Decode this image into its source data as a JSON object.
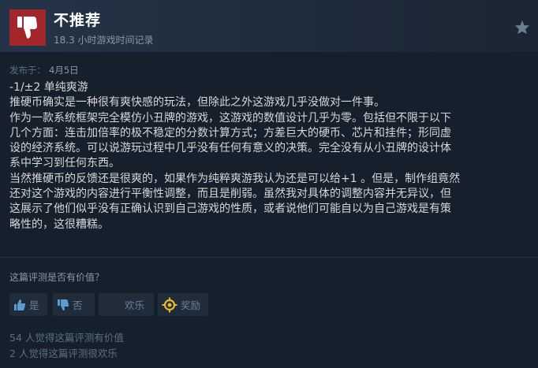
{
  "header": {
    "title": "不推荐",
    "hours": "18.3 小时游戏时间记录",
    "thumb_icon": "thumbs-down-icon",
    "star_icon": "star-icon"
  },
  "posted": {
    "label": "发布于：",
    "date": "4月5日"
  },
  "review": {
    "lines": [
      "-1/±2 单纯爽游",
      "推硬币确实是一种很有爽快感的玩法，但除此之外这游戏几乎没做对一件事。",
      "作为一款系统框架完全模仿小丑牌的游戏，这游戏的数值设计几乎为零。包括但不限于以下",
      "几个方面：连击加倍率的极不稳定的分数计算方式；方差巨大的硬币、芯片和挂件；形同虚",
      "设的经济系统。可以说游玩过程中几乎没有任何有意义的决策。完全没有从小丑牌的设计体",
      "系中学习到任何东西。",
      "当然推硬币的反馈还是很爽的，如果作为纯粹爽游我认为还是可以给+1 。但是，制作组竟然",
      "还对这个游戏的内容进行平衡性调整，而且是削弱。虽然我对具体的调整内容并无异议，但",
      "这展示了他们似乎没有正确认识到自己游戏的性质，或者说他们可能自以为自己游戏是有策",
      "略性的，这很糟糕。"
    ]
  },
  "rating": {
    "question": "这篇评测是否有价值？",
    "yes_label": "是",
    "no_label": "否",
    "funny_label": "欢乐",
    "award_label": "奖励"
  },
  "stats": {
    "helpful": "54 人觉得这篇评测有价值",
    "funny": "2 人觉得这篇评测很欢乐"
  },
  "colors": {
    "background": "#16202d",
    "thumb_box": "#a3262b",
    "button_bg": "#212c3a",
    "button_icon": "#5b9dd0",
    "award_icon": "#e8b931"
  }
}
